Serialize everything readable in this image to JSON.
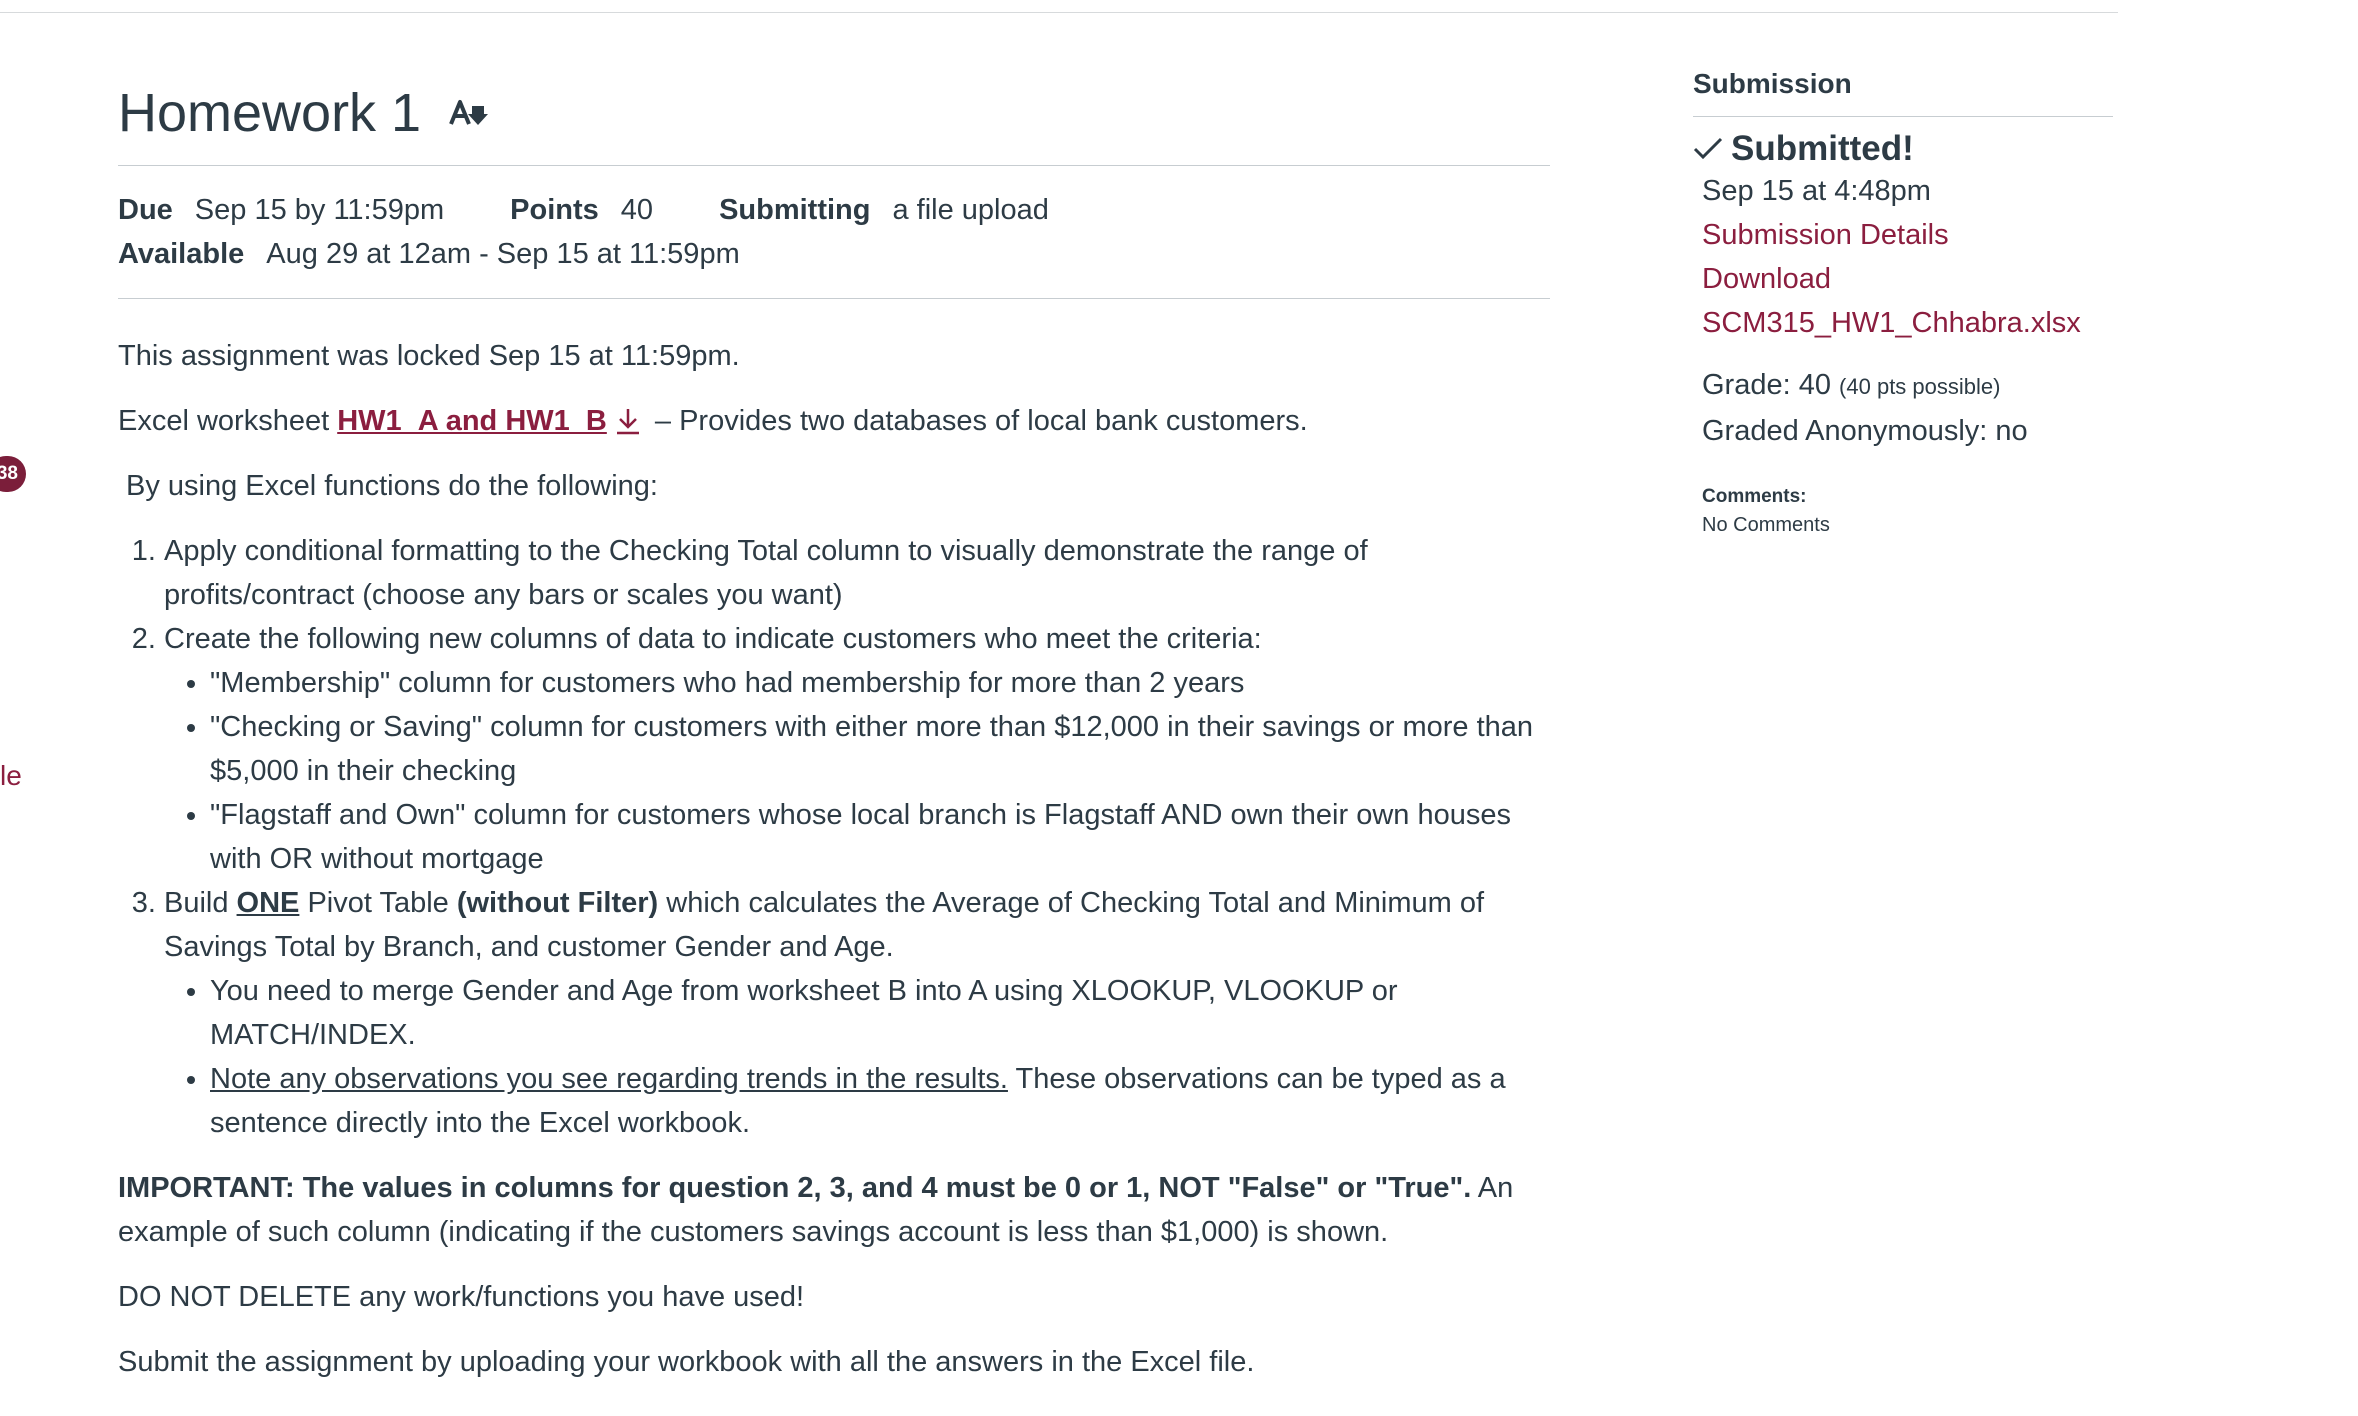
{
  "edge": {
    "badge": "38",
    "text": "le"
  },
  "assignment": {
    "title": "Homework 1",
    "due_label": "Due",
    "due_value": "Sep 15 by 11:59pm",
    "points_label": "Points",
    "points_value": "40",
    "submitting_label": "Submitting",
    "submitting_value": "a file upload",
    "available_label": "Available",
    "available_value": "Aug 29 at 12am - Sep 15 at 11:59pm"
  },
  "content": {
    "locked_notice": "This assignment was locked Sep 15 at 11:59pm.",
    "worksheet_prefix": "Excel worksheet ",
    "worksheet_link": "HW1_A and HW1_B",
    "worksheet_suffix": "– Provides two databases of local bank customers.",
    "intro": "By using Excel functions do the following:",
    "step1": "Apply conditional formatting to the Checking Total column to visually demonstrate the range of profits/contract (choose any bars or scales you want)",
    "step2": "Create the following new columns of data to indicate customers who meet the criteria:",
    "step2_bullets": [
      "\"Membership\" column for customers who had membership for more than 2 years",
      "\"Checking or Saving\" column for customers with either more than $12,000 in their savings or more than $5,000 in their checking",
      "\"Flagstaff and Own\" column for customers whose local branch is Flagstaff AND own their own houses with OR without mortgage"
    ],
    "step3_a": "Build ",
    "step3_b": "ONE",
    "step3_c": " Pivot Table ",
    "step3_d": "(without Filter)",
    "step3_e": " which calculates the Average of Checking Total and Minimum of Savings Total by Branch, and customer Gender and Age.",
    "step3_bullet1": "You need to merge Gender and Age from worksheet B into A using XLOOKUP, VLOOKUP or MATCH/INDEX.",
    "step3_bullet2_underlined": "Note any observations you see regarding trends in the results.",
    "step3_bullet2_rest": " These observations can be typed as a sentence directly into the Excel workbook.",
    "important_bold": "IMPORTANT: The values in columns for question 2, 3, and 4 must be 0 or 1, NOT \"False\" or \"True\".",
    "important_rest": "  An example of such column (indicating if the customers savings account is less than $1,000) is shown.",
    "do_not_delete": "DO NOT DELETE any work/functions you have used!",
    "submit_instruction": "Submit the assignment by uploading your workbook with all the answers in the Excel file."
  },
  "sidebar": {
    "heading": "Submission",
    "status": "Submitted!",
    "submitted_at": "Sep 15 at 4:48pm",
    "details_link": "Submission Details",
    "download_link": "Download",
    "file_link": "SCM315_HW1_Chhabra.xlsx",
    "grade_label": "Grade: 40",
    "grade_possible": "(40 pts possible)",
    "graded_anonymously": "Graded Anonymously: no",
    "comments_label": "Comments:",
    "comments_value": "No Comments"
  },
  "colors": {
    "text": "#2d3b45",
    "link": "#8b1e3f",
    "badge": "#7b1e3a",
    "divider": "#c7cdd1"
  },
  "icons": [
    "assignment-icon",
    "download-icon",
    "checkmark-icon"
  ]
}
